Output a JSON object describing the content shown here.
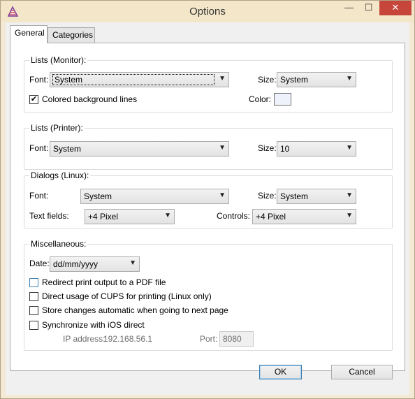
{
  "window": {
    "title": "Options",
    "minimize": "—",
    "maximize": "☐",
    "close": "✕"
  },
  "tabs": [
    {
      "label": "General",
      "active": true
    },
    {
      "label": "Categories",
      "active": false
    }
  ],
  "lists_monitor": {
    "title": "Lists (Monitor):",
    "font_label": "Font:",
    "font_value": "System",
    "size_label": "Size:",
    "size_value": "System",
    "colored_bg_label": "Colored background lines",
    "colored_bg_checked": "✔",
    "color_label": "Color:",
    "color_value": "#eef2fa"
  },
  "lists_printer": {
    "title": "Lists (Printer):",
    "font_label": "Font:",
    "font_value": "System",
    "size_label": "Size:",
    "size_value": "10"
  },
  "dialogs_linux": {
    "title": "Dialogs (Linux):",
    "font_label": "Font:",
    "font_value": "System",
    "size_label": "Size:",
    "size_value": "System",
    "textfields_label": "Text fields:",
    "textfields_value": "+4 Pixel",
    "controls_label": "Controls:",
    "controls_value": "+4 Pixel"
  },
  "misc": {
    "title": "Miscellaneous:",
    "date_label": "Date:",
    "date_value": "dd/mm/yyyy",
    "options": [
      {
        "label": "Redirect print output to a PDF file",
        "checked": ""
      },
      {
        "label": "Direct usage of CUPS for printing (Linux only)",
        "checked": ""
      },
      {
        "label": "Store changes automatic when going to next page",
        "checked": ""
      },
      {
        "label": "Synchronize with iOS direct",
        "checked": ""
      }
    ],
    "ip_label": "IP address:",
    "ip_value": "192.168.56.1",
    "port_label": "Port:",
    "port_value": "8080"
  },
  "footer": {
    "ok_label": "OK",
    "cancel_label": "Cancel"
  },
  "icons": {
    "dropdown_arrow": "▼"
  }
}
